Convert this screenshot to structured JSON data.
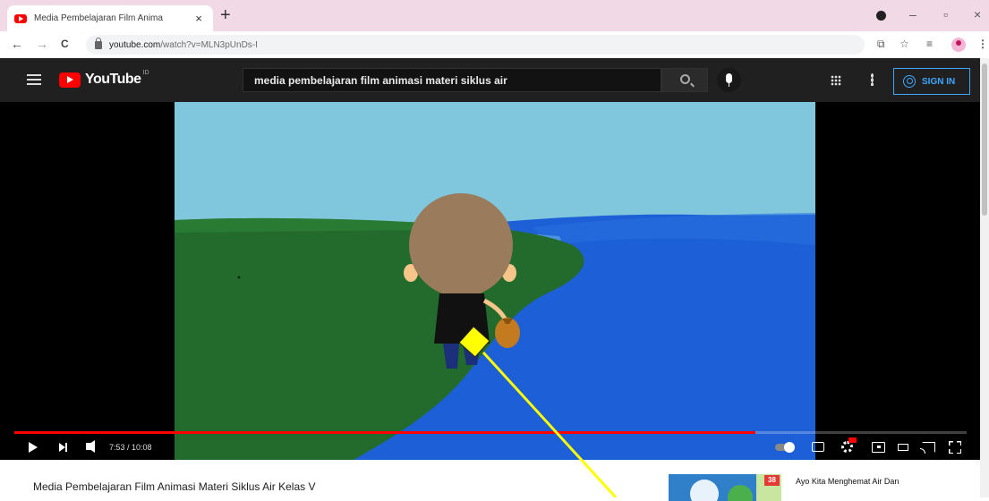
{
  "browser": {
    "tab_title": "Media Pembelajaran Film Anima",
    "tab_close": "×",
    "new_tab": "+",
    "window_controls": {
      "minimize": "–",
      "restore": "▫",
      "close": "×"
    },
    "nav": {
      "back": "←",
      "forward": "→",
      "reload": "C"
    },
    "url_host": "youtube.com",
    "url_path": "/watch?v=MLN3pUnDs-I",
    "right_icons": [
      "translate-icon",
      "star-icon",
      "reading-list-icon",
      "profile-icon",
      "kebab-menu-icon"
    ]
  },
  "youtube": {
    "logo_text": "YouTube",
    "region": "ID",
    "search_query": "media pembelajaran film animasi materi siklus air",
    "sign_in": "SIGN IN"
  },
  "player": {
    "time": "7:53 / 10:08",
    "progress": 0.778,
    "scene": "animated boy with sack walking beside a river"
  },
  "video": {
    "title": "Media Pembelajaran Film Animasi Materi Siklus Air Kelas V"
  },
  "recommendation": {
    "badge": "38",
    "title": "Ayo Kita Menghemat Air Dan"
  },
  "colors": {
    "tabstrip": "#f2d9e6",
    "yt_bar": "#202020",
    "accent_blue": "#3ea6ff",
    "progress_red": "#ff0000",
    "sky": "#80c6dc",
    "grass": "#236b2c",
    "water": "#1c5fd6",
    "arrow": "#ffff00"
  }
}
